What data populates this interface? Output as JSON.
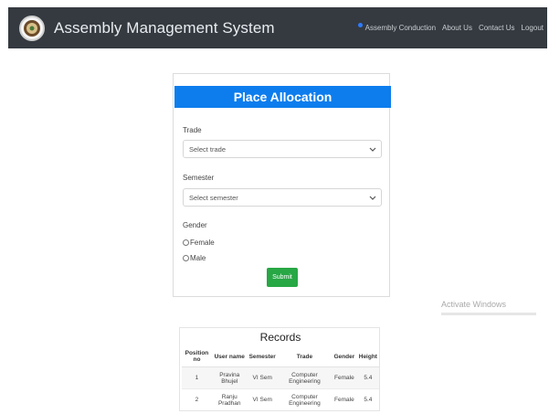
{
  "navbar": {
    "brand": "Assembly Management System",
    "links": [
      "Assembly Conduction",
      "About Us",
      "Contact Us",
      "Logout"
    ]
  },
  "form": {
    "title": "Place Allocation",
    "trade_label": "Trade",
    "trade_value": "Select trade",
    "semester_label": "Semester",
    "semester_value": "Select semester",
    "gender_label": "Gender",
    "gender_options": [
      "Female",
      "Male"
    ],
    "submit_label": "Submit"
  },
  "watermark": "Activate Windows",
  "records": {
    "title": "Records",
    "columns": [
      "Position no",
      "User name",
      "Semester",
      "Trade",
      "Gender",
      "Height"
    ],
    "rows": [
      [
        "1",
        "Pravina Bhujel",
        "VI Sem",
        "Computer Engineering",
        "Female",
        "5.4"
      ],
      [
        "2",
        "Ranju Pradhan",
        "VI Sem",
        "Computer Engineering",
        "Female",
        "5.4"
      ]
    ]
  },
  "colors": {
    "navbar": "#343a40",
    "header": "#0d7dee",
    "submit": "#28a745"
  }
}
